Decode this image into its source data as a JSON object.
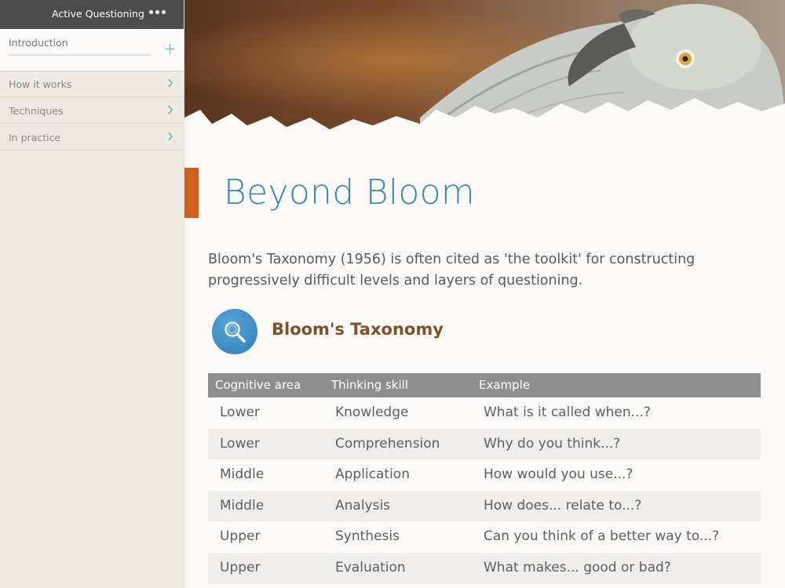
{
  "sidebar": {
    "title": "Active Questioning",
    "intro_label": "Introduction",
    "items": [
      {
        "label": "How it works"
      },
      {
        "label": "Techniques"
      },
      {
        "label": "In practice"
      }
    ]
  },
  "main": {
    "title": "Beyond Bloom",
    "intro": "Bloom's Taxonomy (1956) is often cited as 'the toolkit' for constructing progressively difficult levels and layers of questioning.",
    "section_title": "Bloom's Taxonomy",
    "table": {
      "headers": [
        "Cognitive area",
        "Thinking skill",
        "Example"
      ],
      "rows": [
        [
          "Lower",
          "Knowledge",
          "What is it called when...?"
        ],
        [
          "Lower",
          "Comprehension",
          "Why do you think...?"
        ],
        [
          "Middle",
          "Application",
          "How would you use...?"
        ],
        [
          "Middle",
          "Analysis",
          "How does... relate to...?"
        ],
        [
          "Upper",
          "Synthesis",
          "Can you think of a better way to...?"
        ],
        [
          "Upper",
          "Evaluation",
          "What makes... good or bad?"
        ]
      ]
    }
  },
  "colors": {
    "accent": "#d2601c",
    "title_blue": "#3a86b8",
    "teal": "#59b6b0",
    "section_brown": "#7b5229"
  },
  "icons": [
    "more-icon",
    "plus-icon",
    "chevron-right-icon",
    "magnifier-icon"
  ]
}
